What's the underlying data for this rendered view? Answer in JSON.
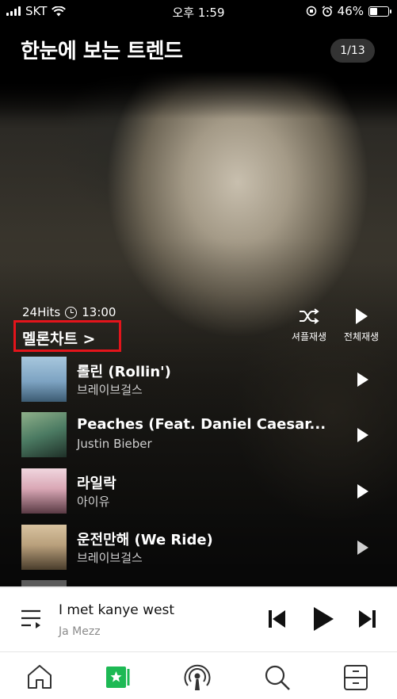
{
  "status": {
    "carrier": "SKT",
    "time": "오후 1:59",
    "battery": "46%"
  },
  "header": {
    "title": "한눈에 보는 트렌드",
    "pager": "1/13"
  },
  "chart": {
    "hits_label": "24Hits",
    "time": "13:00",
    "name": "멜론차트 >",
    "shuffle_label": "셔플재생",
    "playall_label": "전체재생"
  },
  "songs": [
    {
      "title": "롤린 (Rollin')",
      "artist": "브레이브걸스",
      "art_color": "#7da3c2"
    },
    {
      "title": "Peaches (Feat. Daniel Caesar...",
      "artist": "Justin Bieber",
      "art_color": "#4b7a62"
    },
    {
      "title": "라일락",
      "artist": "아이유",
      "art_color": "#d9a7b5"
    },
    {
      "title": "운전만해 (We Ride)",
      "artist": "브레이브걸스",
      "art_color": "#b9a07c"
    }
  ],
  "mini_player": {
    "title": "I met kanye west",
    "artist": "Ja Mezz"
  },
  "nav": {
    "items": [
      "home-icon",
      "music-icon",
      "podcast-icon",
      "search-icon",
      "library-icon"
    ]
  },
  "colors": {
    "accent": "#1db954",
    "highlight": "#e3141b"
  }
}
